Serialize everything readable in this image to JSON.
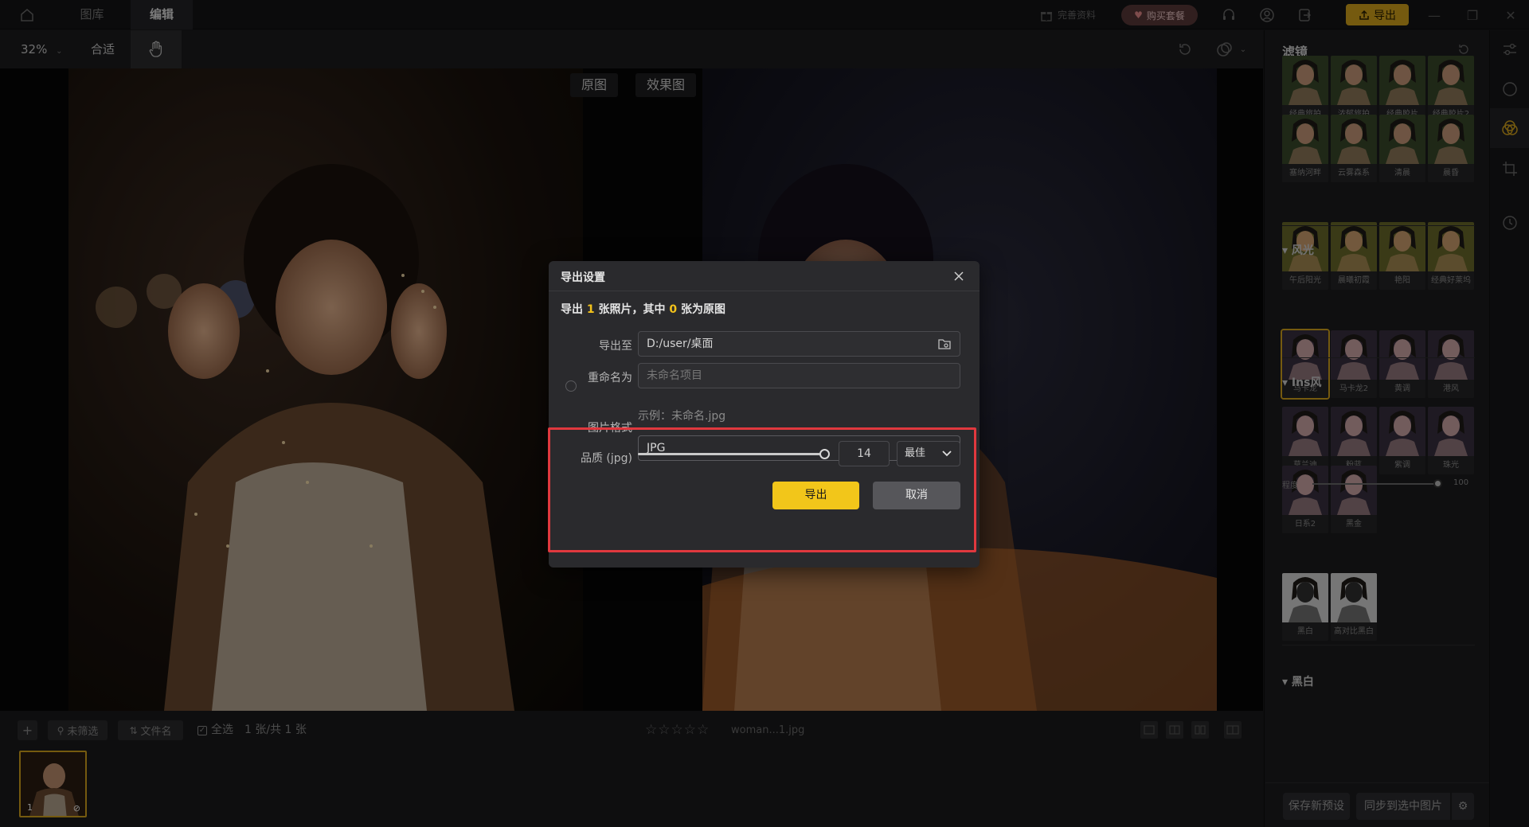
{
  "topbar": {
    "tabs": [
      {
        "label": "图库"
      },
      {
        "label": "编辑"
      }
    ],
    "gift_label": "完善资料",
    "buy_label": "购买套餐",
    "export_label": "导出"
  },
  "toolbar": {
    "zoom": "32%",
    "fit_label": "合适"
  },
  "compare": {
    "before_label": "原图",
    "after_label": "效果图"
  },
  "bottombar": {
    "filter_label": "未筛选",
    "sort_label": "文件名",
    "select_all_label": "全选",
    "count_text": "1 张/共 1 张",
    "stars": [
      "☆",
      "☆",
      "☆",
      "☆",
      "☆"
    ],
    "rating": 0,
    "filename": "woman...1.jpg",
    "thumb_number": "1"
  },
  "rpanel": {
    "title": "滤镜",
    "filters_row1": [
      "经典旅拍",
      "浓郁旅拍",
      "经典胶片",
      "经典胶片2"
    ],
    "filters_row2": [
      "塞纳河畔",
      "云雾森系",
      "清晨",
      "晨昏"
    ],
    "section_sun": "风光",
    "sun_items": [
      "午后阳光",
      "晨曦初霞",
      "艳阳",
      "经典好莱坞"
    ],
    "section_ins": "Ins风",
    "ins_row1": [
      "马卡龙",
      "马卡龙2",
      "黄调",
      "港风"
    ],
    "degree_label": "程度",
    "degree_value": "100",
    "ins_row2": [
      "莫兰迪",
      "粉蓝",
      "紫调",
      "珠光"
    ],
    "ins_row3": [
      "日系2",
      "黑金"
    ],
    "section_bw": "黑白",
    "bw_items": [
      "黑白",
      "高对比黑白"
    ],
    "save_preset_label": "保存新预设",
    "sync_label": "同步到选中图片"
  },
  "dialog": {
    "title": "导出设置",
    "summary_pre": "导出 ",
    "summary_count": "1",
    "summary_mid": " 张照片，其中 ",
    "summary_orig": "0",
    "summary_post": " 张为原图",
    "export_to_label": "导出至",
    "export_path": "D:/user/桌面",
    "rename_label": "重命名为",
    "rename_placeholder": "未命名项目",
    "example_text": "示例：未命名.jpg",
    "format_label": "图片格式",
    "format_value": "JPG",
    "quality_label": "品质 (jpg)",
    "quality_value": "14",
    "quality_level": 1.0,
    "quality_preset": "最佳",
    "export_button": "导出",
    "cancel_button": "取消"
  },
  "colors": {
    "accent": "#f2c61a",
    "highlight": "#e0383e",
    "panel": "#2a2a2d"
  }
}
